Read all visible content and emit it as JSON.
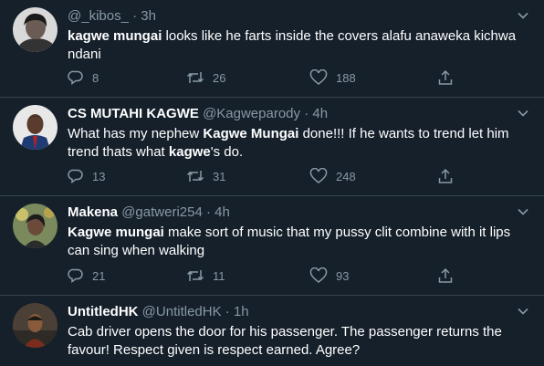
{
  "colors": {
    "background": "#15202b",
    "divider": "#38444d",
    "muted": "#8899a6",
    "text": "#ffffff"
  },
  "tweets": [
    {
      "name": "",
      "handle": "@_kibos_",
      "dot": "·",
      "time": "3h",
      "text_parts": [
        "kagwe mungai",
        " looks like he farts inside the covers alafu anaweka kichwa ndani"
      ],
      "replies": "8",
      "retweets": "26",
      "likes": "188"
    },
    {
      "name": "CS MUTAHI KAGWE",
      "handle": "@Kagweparody",
      "dot": "·",
      "time": "4h",
      "text_parts": [
        "What has my nephew ",
        "Kagwe Mungai",
        " done!!! If he wants to trend let him trend thats what ",
        "kagwe",
        "'s do."
      ],
      "replies": "13",
      "retweets": "31",
      "likes": "248"
    },
    {
      "name": "Makena",
      "handle": "@gatweri254",
      "dot": "·",
      "time": "4h",
      "text_parts": [
        "Kagwe mungai",
        " make sort of music that my pussy clit combine with it lips can sing when walking"
      ],
      "replies": "21",
      "retweets": "11",
      "likes": "93"
    },
    {
      "name": "UntitledHK",
      "handle": "@UntitledHK",
      "dot": "·",
      "time": "1h",
      "text_parts": [
        "Cab driver opens the door for his passenger. The passenger returns the favour! Respect given is respect earned. Agree?"
      ]
    }
  ],
  "icons": {
    "avatar": "avatar",
    "caret": "chevron-down-icon",
    "reply": "reply-icon",
    "retweet": "retweet-icon",
    "like": "heart-icon",
    "share": "share-icon"
  }
}
